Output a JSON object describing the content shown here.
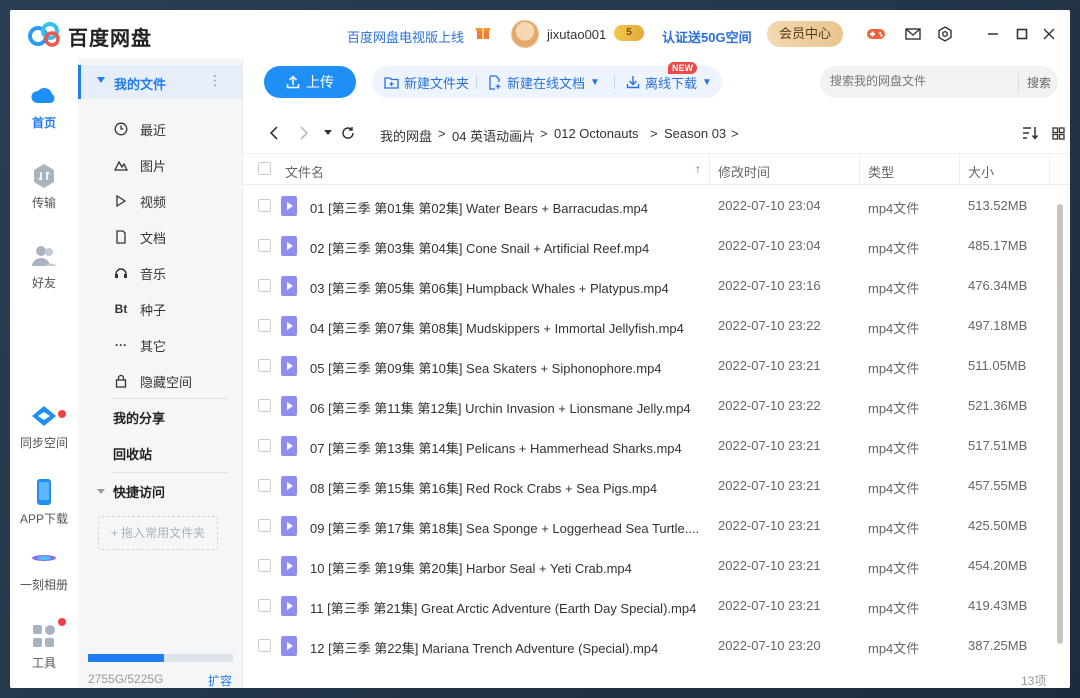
{
  "app": {
    "brand": "百度网盘",
    "tv_link": "百度网盘电视版上线",
    "username": "jixutao001",
    "vip_badge": "5",
    "verify_link": "认证送50G空间",
    "member_button": "会员中心"
  },
  "rail": {
    "items": [
      {
        "label": "首页",
        "icon": "cloud-icon",
        "active": true
      },
      {
        "label": "传输",
        "icon": "transfer-icon"
      },
      {
        "label": "好友",
        "icon": "friends-icon"
      },
      {
        "label": "同步空间",
        "icon": "sync-icon"
      },
      {
        "label": "APP下载",
        "icon": "phone-icon"
      },
      {
        "label": "一刻相册",
        "icon": "album-icon"
      },
      {
        "label": "工具",
        "icon": "tools-icon"
      }
    ]
  },
  "sidebar": {
    "my_files": "我的文件",
    "items": [
      {
        "label": "最近",
        "icon": "clock-icon"
      },
      {
        "label": "图片",
        "icon": "image-icon"
      },
      {
        "label": "视频",
        "icon": "video-icon"
      },
      {
        "label": "文档",
        "icon": "document-icon"
      },
      {
        "label": "音乐",
        "icon": "headphone-icon"
      },
      {
        "label": "种子",
        "icon": "torrent-icon",
        "glyph": "Bt"
      },
      {
        "label": "其它",
        "icon": "more-icon"
      },
      {
        "label": "隐藏空间",
        "icon": "lock-icon"
      }
    ],
    "my_share": "我的分享",
    "recycle": "回收站",
    "quick_access": "快捷访问",
    "drop_hint": "+ 拖入常用文件夹",
    "storage_text": "2755G/5225G",
    "storage_used": 2755,
    "storage_total": 5225,
    "expand": "扩容"
  },
  "toolbar": {
    "upload": "上传",
    "new_folder": "新建文件夹",
    "new_doc": "新建在线文档",
    "new_tag": "NEW",
    "offline_download": "离线下载",
    "search_placeholder": "搜索我的网盘文件",
    "search_button": "搜索"
  },
  "breadcrumb": [
    "我的网盘",
    "04 英语动画片",
    "012 Octonauts",
    "Season 03"
  ],
  "table": {
    "headers": {
      "name": "文件名",
      "modified": "修改时间",
      "type": "类型",
      "size": "大小"
    },
    "rows": [
      {
        "name": "01 [第三季 第01集 第02集] Water Bears + Barracudas.mp4",
        "modified": "2022-07-10 23:04",
        "type": "mp4文件",
        "size": "513.52MB"
      },
      {
        "name": "02 [第三季 第03集 第04集] Cone Snail + Artificial Reef.mp4",
        "modified": "2022-07-10 23:04",
        "type": "mp4文件",
        "size": "485.17MB"
      },
      {
        "name": "03 [第三季 第05集 第06集] Humpback Whales + Platypus.mp4",
        "modified": "2022-07-10 23:16",
        "type": "mp4文件",
        "size": "476.34MB"
      },
      {
        "name": "04 [第三季 第07集 第08集] Mudskippers + Immortal Jellyfish.mp4",
        "modified": "2022-07-10 23:22",
        "type": "mp4文件",
        "size": "497.18MB"
      },
      {
        "name": "05 [第三季 第09集 第10集] Sea Skaters + Siphonophore.mp4",
        "modified": "2022-07-10 23:21",
        "type": "mp4文件",
        "size": "511.05MB"
      },
      {
        "name": "06 [第三季 第11集 第12集] Urchin Invasion + Lionsmane Jelly.mp4",
        "modified": "2022-07-10 23:22",
        "type": "mp4文件",
        "size": "521.36MB"
      },
      {
        "name": "07 [第三季 第13集 第14集] Pelicans + Hammerhead Sharks.mp4",
        "modified": "2022-07-10 23:21",
        "type": "mp4文件",
        "size": "517.51MB"
      },
      {
        "name": "08 [第三季 第15集 第16集] Red Rock Crabs + Sea Pigs.mp4",
        "modified": "2022-07-10 23:21",
        "type": "mp4文件",
        "size": "457.55MB"
      },
      {
        "name": "09 [第三季 第17集 第18集] Sea Sponge + Loggerhead Sea Turtle....",
        "modified": "2022-07-10 23:21",
        "type": "mp4文件",
        "size": "425.50MB"
      },
      {
        "name": "10 [第三季 第19集 第20集] Harbor Seal + Yeti Crab.mp4",
        "modified": "2022-07-10 23:21",
        "type": "mp4文件",
        "size": "454.20MB"
      },
      {
        "name": "11 [第三季 第21集] Great Arctic Adventure (Earth Day Special).mp4",
        "modified": "2022-07-10 23:21",
        "type": "mp4文件",
        "size": "419.43MB"
      },
      {
        "name": "12 [第三季 第22集] Mariana Trench Adventure (Special).mp4",
        "modified": "2022-07-10 23:20",
        "type": "mp4文件",
        "size": "387.25MB"
      }
    ]
  },
  "footer": {
    "count": "13项"
  },
  "colors": {
    "accent": "#1f7cf2",
    "link": "#2a6fdb",
    "file_icon": "#8f8ef0"
  }
}
